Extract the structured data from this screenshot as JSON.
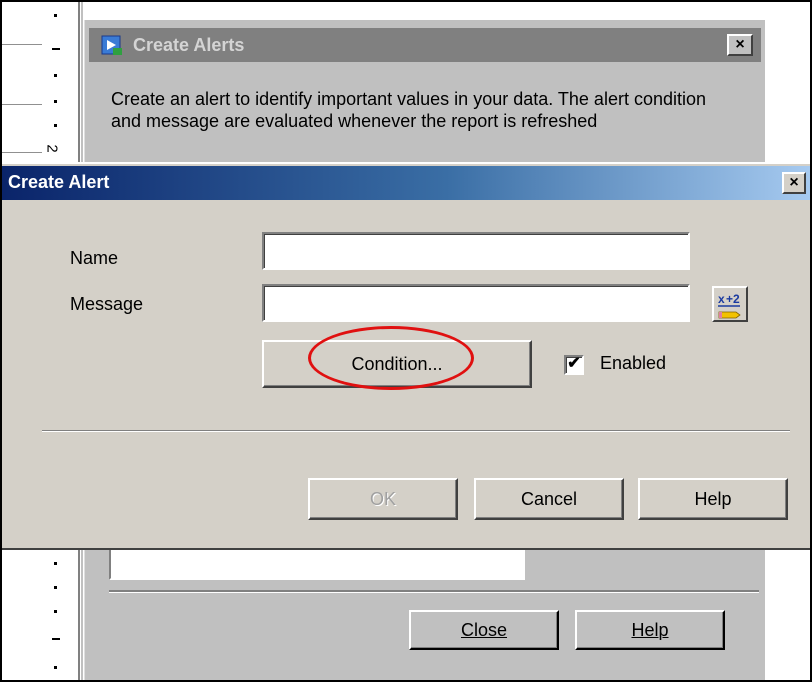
{
  "ruler": {
    "number": "2"
  },
  "background_dialog": {
    "title": "Create Alerts",
    "close_glyph": "×",
    "description": "Create an alert to identify important values in your data. The alert condition and message are evaluated whenever the report is refreshed",
    "close_label": "Close",
    "help_label": "Help"
  },
  "dialog": {
    "title": "Create Alert",
    "close_glyph": "×",
    "name_label": "Name",
    "name_value": "",
    "message_label": "Message",
    "message_value": "",
    "condition_label": "Condition...",
    "enabled_label": "Enabled",
    "enabled_checked": true,
    "checkmark": "✔",
    "ok_label": "OK",
    "cancel_label": "Cancel",
    "help_label": "Help"
  },
  "annotation": {
    "color": "#e01010"
  },
  "colors": {
    "title_start": "#0a246a",
    "title_end": "#a6caf0",
    "dialog_face": "#d4d0c8"
  },
  "icons": {
    "expression": "formula-icon",
    "app": "report-icon"
  }
}
